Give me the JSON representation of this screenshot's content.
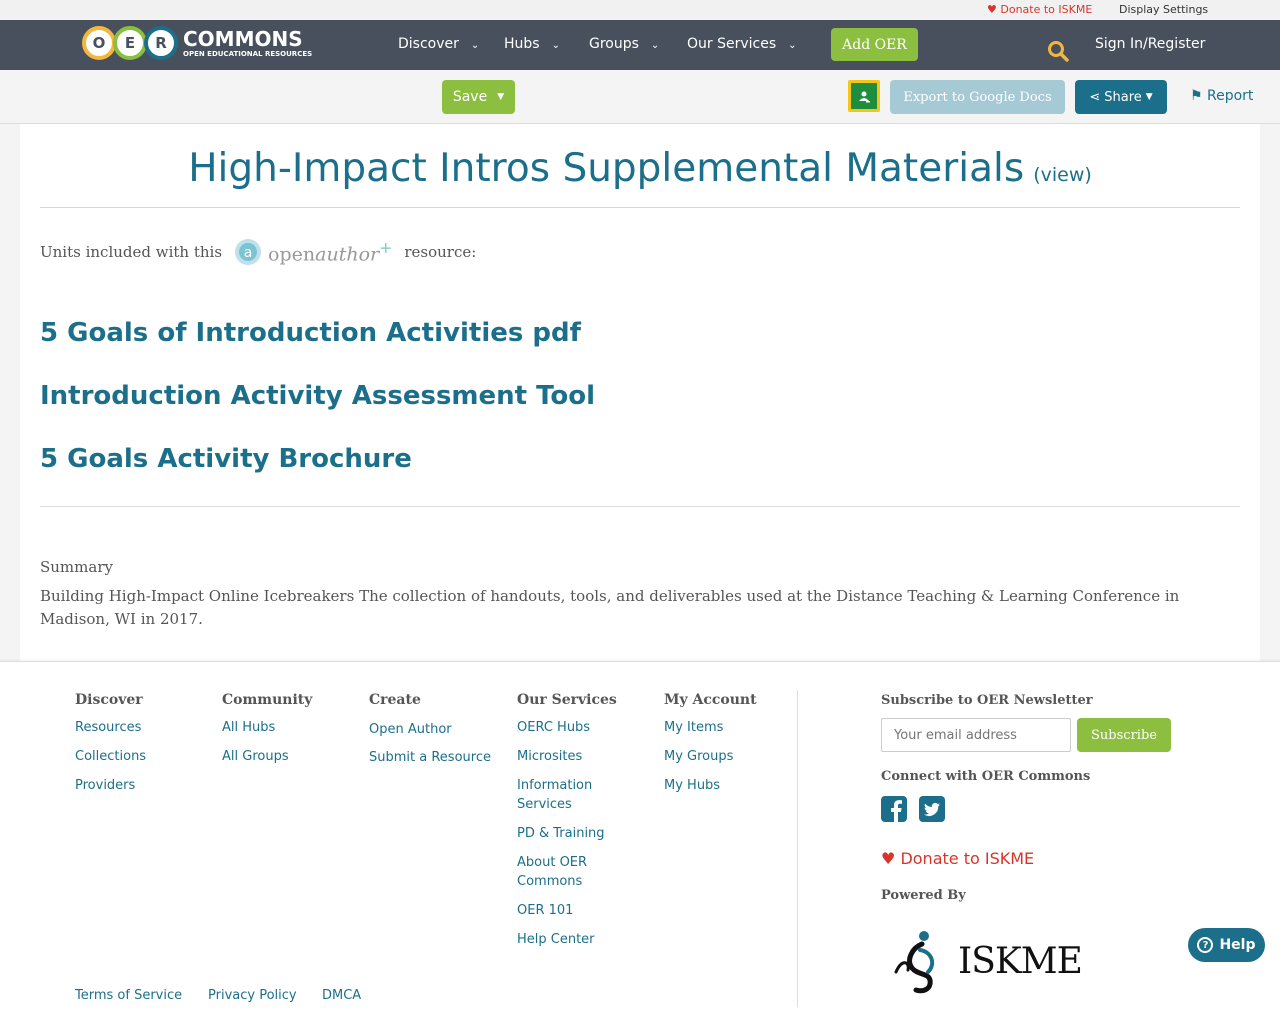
{
  "topbar": {
    "donate": "Donate to ISKME",
    "display_settings": "Display Settings"
  },
  "nav": {
    "logo_letters": [
      "O",
      "E",
      "R"
    ],
    "logo_title": "COMMONS",
    "logo_subtitle": "OPEN EDUCATIONAL RESOURCES",
    "items": [
      {
        "label": "Discover"
      },
      {
        "label": "Hubs"
      },
      {
        "label": "Groups"
      },
      {
        "label": "Our Services"
      }
    ],
    "add_oer": "Add OER",
    "sign_in": "Sign In/Register"
  },
  "toolbar": {
    "save": "Save",
    "export": "Export to Google Docs",
    "share": "Share",
    "report": "Report"
  },
  "main": {
    "title": "High-Impact Intros Supplemental Materials",
    "view_link": "(view)",
    "units_prefix": "Units included with this",
    "units_suffix": "resource:",
    "openauthor_a": "open",
    "openauthor_b": "author",
    "openauthor_plus": "+",
    "units": [
      "5 Goals of Introduction Activities pdf",
      "Introduction Activity Assessment Tool",
      "5 Goals Activity Brochure"
    ],
    "summary_heading": "Summary",
    "summary_text": "Building High-Impact Online Icebreakers The collection of handouts, tools, and deliverables used at the Distance Teaching & Learning Conference in Madison, WI in 2017."
  },
  "footer": {
    "discover": {
      "heading": "Discover",
      "links": [
        "Resources",
        "Collections",
        "Providers"
      ]
    },
    "community": {
      "heading": "Community",
      "links": [
        "All Hubs",
        "All Groups"
      ]
    },
    "create": {
      "heading": "Create",
      "links": [
        "Open Author",
        "Submit a Resource"
      ]
    },
    "services": {
      "heading": "Our Services",
      "links": [
        "OERC Hubs",
        "Microsites",
        "Information Services",
        "PD & Training",
        "About OER Commons",
        "OER 101",
        "Help Center"
      ]
    },
    "account": {
      "heading": "My Account",
      "links": [
        "My Items",
        "My Groups",
        "My Hubs"
      ]
    },
    "newsletter_heading": "Subscribe to OER Newsletter",
    "email_placeholder": "Your email address",
    "subscribe": "Subscribe",
    "connect_heading": "Connect with OER Commons",
    "donate": "Donate to ISKME",
    "powered_by": "Powered By",
    "iskme_logo_text": "ISKME",
    "help": "Help",
    "legal": [
      "Terms of Service",
      "Privacy Policy",
      "DMCA"
    ]
  },
  "colors": {
    "nav": "#47505c",
    "accent_green": "#8cbf3f",
    "link_blue": "#1c6f8a",
    "donate_red": "#d9342b"
  }
}
